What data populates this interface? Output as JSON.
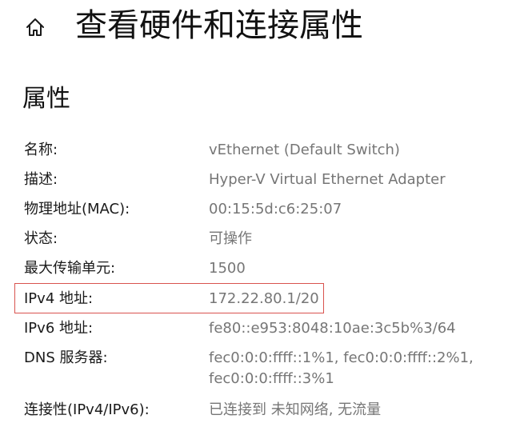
{
  "header": {
    "title": "查看硬件和连接属性",
    "home_icon": "home-icon"
  },
  "section": {
    "title": "属性"
  },
  "properties": [
    {
      "label": "名称:",
      "value": [
        "vEthernet (Default Switch)"
      ]
    },
    {
      "label": "描述:",
      "value": [
        "Hyper-V Virtual Ethernet Adapter"
      ]
    },
    {
      "label": "物理地址(MAC):",
      "value": [
        "00:15:5d:c6:25:07"
      ]
    },
    {
      "label": "状态:",
      "value": [
        "可操作"
      ]
    },
    {
      "label": "最大传输单元:",
      "value": [
        "1500"
      ]
    },
    {
      "label": "IPv4 地址:",
      "value": [
        "172.22.80.1/20"
      ]
    },
    {
      "label": "IPv6 地址:",
      "value": [
        "fe80::e953:8048:10ae:3c5b%3/64"
      ]
    },
    {
      "label": "DNS 服务器:",
      "value": [
        "fec0:0:0:ffff::1%1, fec0:0:0:ffff::2%1,",
        "fec0:0:0:ffff::3%1"
      ]
    },
    {
      "label": "连接性(IPv4/IPv6):",
      "value": [
        "已连接到 未知网络, 无流量"
      ]
    }
  ],
  "highlight": {
    "color": "#d9534f",
    "target": "IPv4 地址:"
  }
}
